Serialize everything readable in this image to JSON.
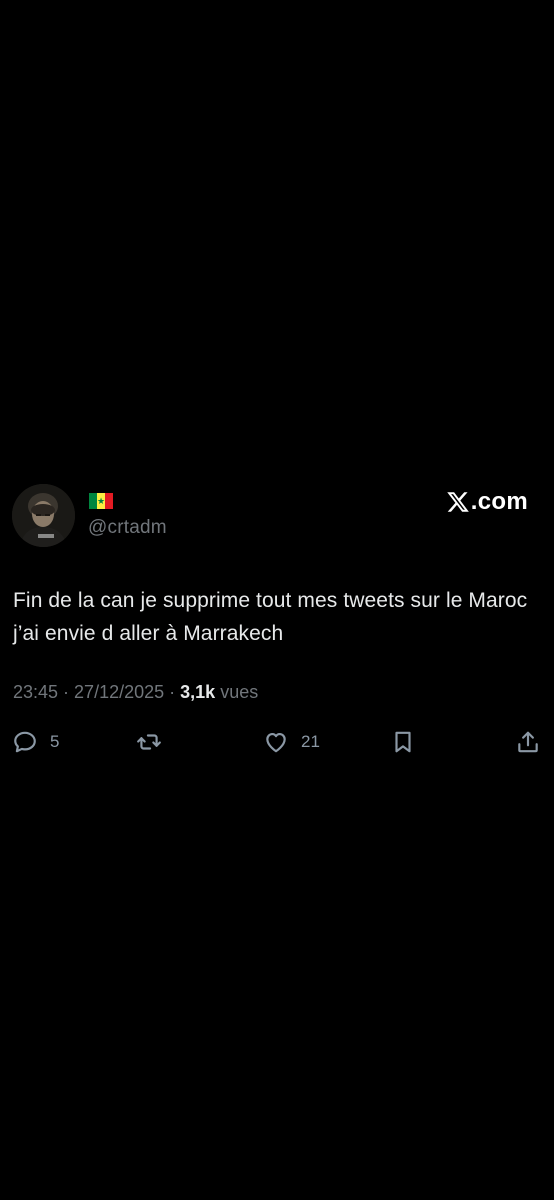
{
  "author": {
    "handle": "@crtadm",
    "name_emoji": "flag-senegal",
    "flag_colors": [
      "#00853f",
      "#fdef42",
      "#e31b23"
    ]
  },
  "brand": {
    "label": ".com",
    "logo_icon": "x-logo-icon"
  },
  "tweet": {
    "text": "Fin de la can je supprime tout mes tweets sur le Maroc j’ai envie d aller à Marrakech",
    "time": "23:45",
    "separator": " · ",
    "date": "27/12/2025",
    "views_count": "3,1k",
    "views_label": "vues"
  },
  "actions": {
    "reply_count": "5",
    "retweet_count": "",
    "like_count": "21"
  },
  "colors": {
    "background": "#000000",
    "text_primary": "#e7e9ea",
    "text_secondary": "#71767b",
    "icon": "#8b98a5"
  }
}
